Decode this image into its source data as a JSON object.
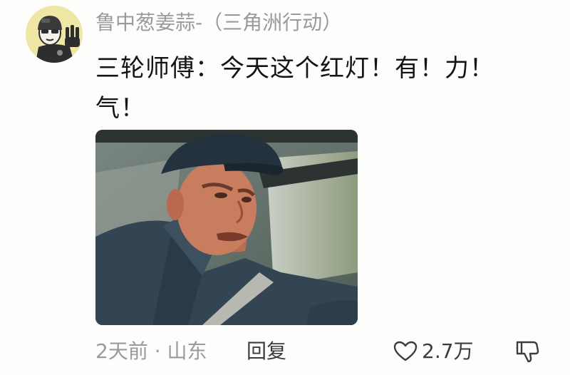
{
  "comment": {
    "username": "鲁中葱姜蒜-（三角洲行动）",
    "text_line1": "三轮师傅：今天这个红灯！有！力！",
    "text_line2": "气！",
    "time": "2天前",
    "separator": " · ",
    "location": "山东",
    "reply_label": "回复",
    "like_count": "2.7万",
    "icons": {
      "avatar": "cartoon-soldier-avatar",
      "like": "heart-outline-icon",
      "dislike": "thumbs-down-icon"
    },
    "colors": {
      "username": "#9a9a9a",
      "text": "#141414",
      "meta": "#9a9a9a",
      "action": "#3c3c3c",
      "avatar_bg": "#efe7a4"
    }
  }
}
